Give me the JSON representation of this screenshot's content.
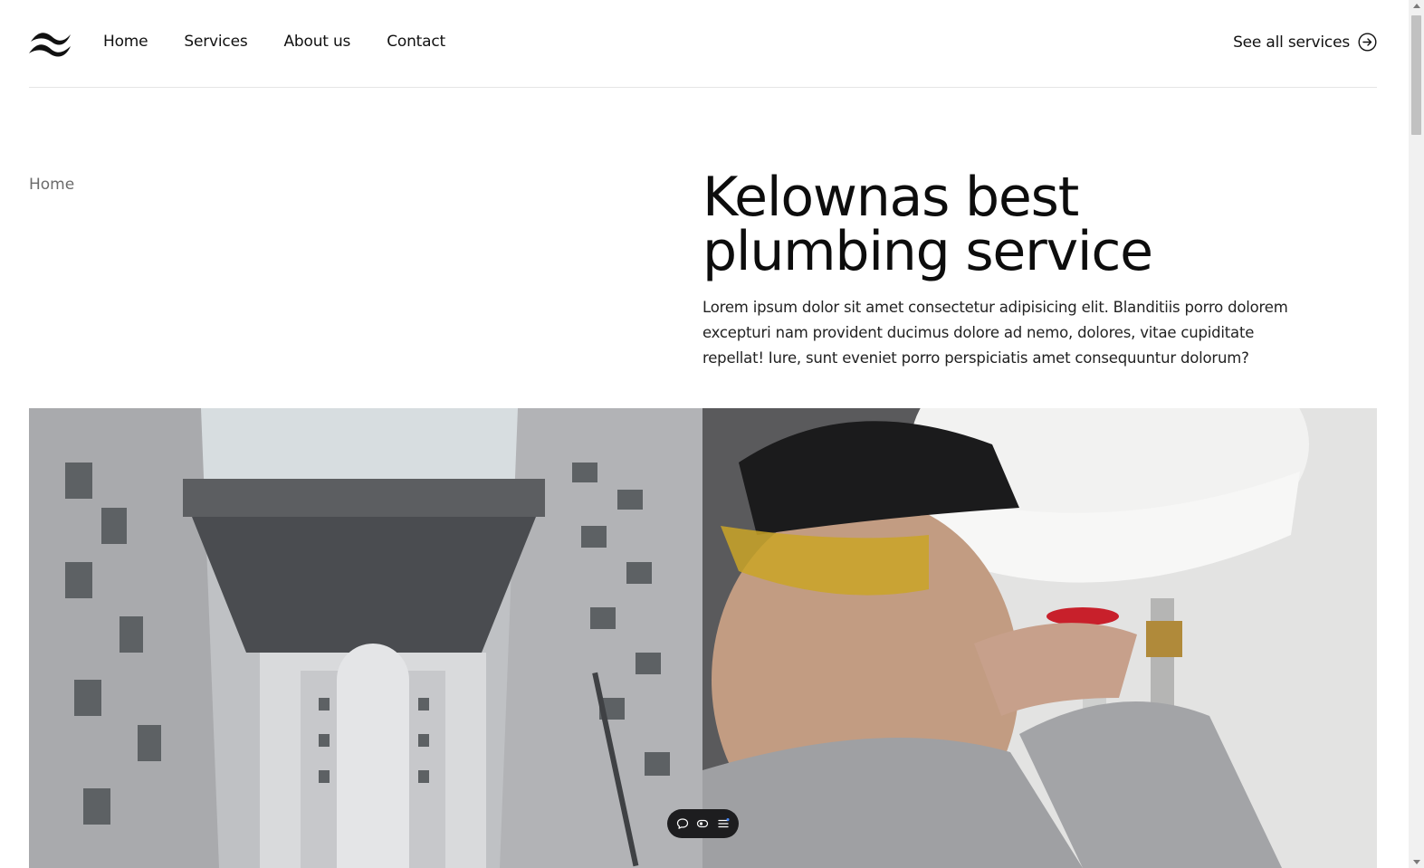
{
  "nav": {
    "links": [
      "Home",
      "Services",
      "About us",
      "Contact"
    ],
    "cta_label": "See all services"
  },
  "breadcrumb": "Home",
  "hero": {
    "title_line1": "Kelownas best",
    "title_line2": "plumbing service",
    "description": "Lorem ipsum dolor sit amet consectetur adipisicing elit. Blanditiis porro dolorem excepturi nam provident ducimus dolore ad nemo, dolores, vitae cupiditate repellat! Iure, sunt eveniet porro perspiciatis amet consequuntur dolorum?"
  },
  "icons": {
    "logo": "wave-logo",
    "cta": "arrow-right-circle-icon",
    "toolbar": [
      "comment-icon",
      "eye-icon",
      "list-icon"
    ]
  },
  "colors": {
    "text": "#111111",
    "muted": "#6b6b6b",
    "toolbar_bg": "#1d1d1f",
    "divider": "#e5e5e5"
  }
}
